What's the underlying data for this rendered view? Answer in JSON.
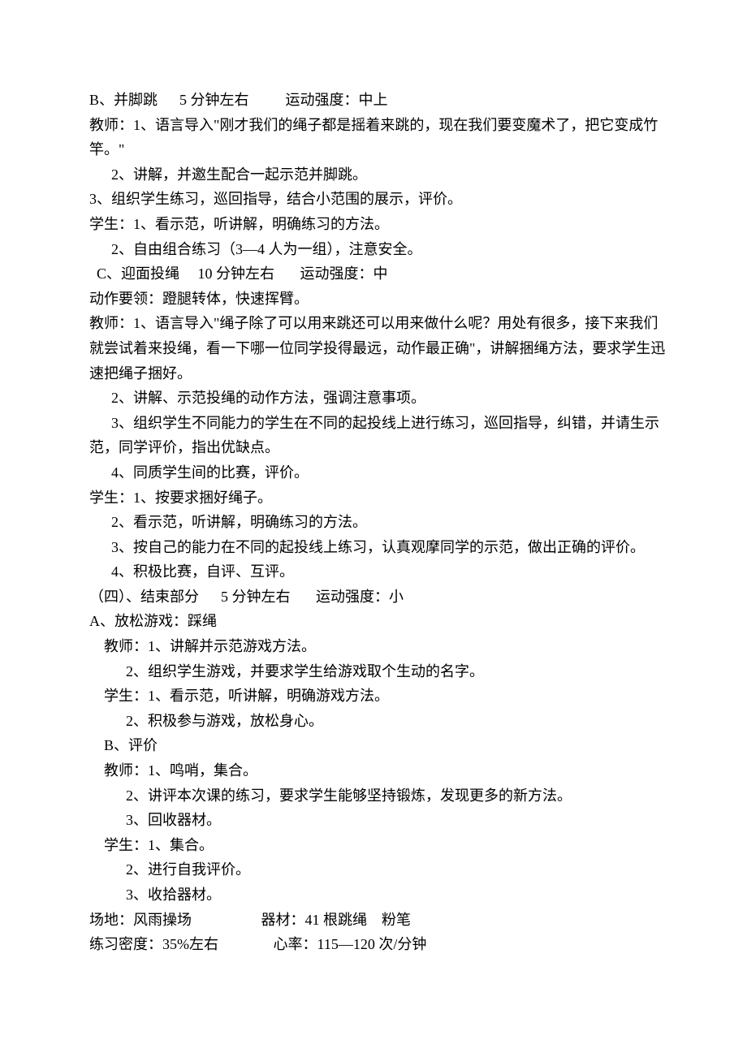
{
  "lines": [
    "B、并脚跳      5 分钟左右          运动强度：中上",
    "教师：1、语言导入\"刚才我们的绳子都是摇着来跳的，现在我们要变魔术了，把它变成竹竿。\"",
    "      2、讲解，并邀生配合一起示范并脚跳。",
    "3、组织学生练习，巡回指导，结合小范围的展示，评价。",
    "学生：1、看示范，听讲解，明确练习的方法。",
    "      2、自由组合练习（3—4 人为一组），注意安全。",
    "  C、迎面投绳     10 分钟左右       运动强度：中",
    "动作要领：蹬腿转体，快速挥臂。",
    "教师：1、语言导入\"绳子除了可以用来跳还可以用来做什么呢？用处有很多，接下来我们就尝试着来投绳，看一下哪一位同学投得最远，动作最正确\"，讲解捆绳方法，要求学生迅速把绳子捆好。",
    "      2、讲解、示范投绳的动作方法，强调注意事项。",
    "      3、组织学生不同能力的学生在不同的起投线上进行练习，巡回指导，纠错，并请生示范，同学评价，指出优缺点。",
    "      4、同质学生间的比赛，评价。",
    "学生：1、按要求捆好绳子。",
    "      2、看示范，听讲解，明确练习的方法。",
    "      3、按自己的能力在不同的起投线上练习，认真观摩同学的示范，做出正确的评价。",
    "      4、积极比赛，自评、互评。",
    "（四）、结束部分      5 分钟左右       运动强度：小",
    "A、放松游戏：踩绳",
    "    教师：1、讲解并示范游戏方法。",
    "          2、组织学生游戏，并要求学生给游戏取个生动的名字。",
    "    学生：1、看示范，听讲解，明确游戏方法。",
    "          2、积极参与游戏，放松身心。",
    "    B、评价",
    "    教师：1、鸣哨，集合。",
    "          2、讲评本次课的练习，要求学生能够坚持锻炼，发现更多的新方法。",
    "          3、回收器材。",
    "    学生：1、集合。",
    "          2、进行自我评价。",
    "          3、收拾器材。",
    "场地：风雨操场                   器材：41 根跳绳    粉笔",
    "练习密度：35%左右               心率：115—120 次/分钟"
  ]
}
